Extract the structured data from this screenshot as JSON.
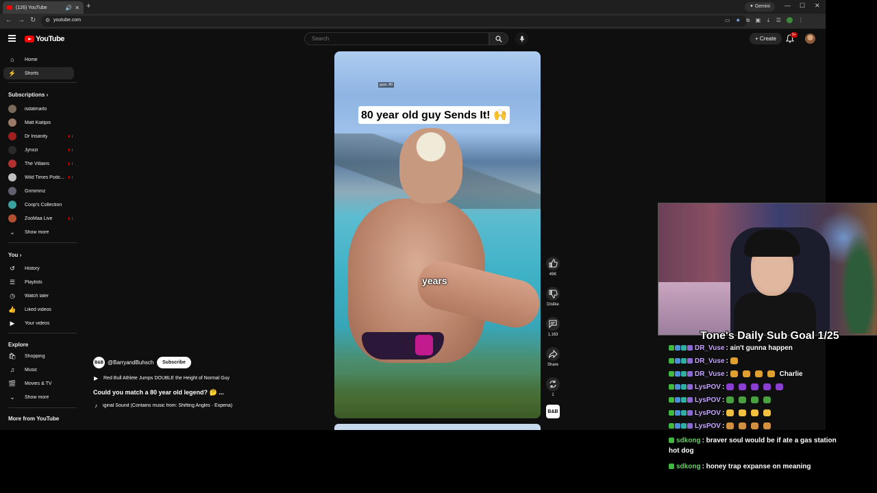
{
  "browser": {
    "tab_title": "(126) YouTube",
    "url": "youtube.com",
    "gemini_label": "Gemini"
  },
  "youtube": {
    "logo_text": "YouTube",
    "search_placeholder": "Search",
    "create_label": "Create",
    "notification_count": "9+",
    "sidebar": {
      "main": [
        {
          "label": "Home",
          "icon": "home-icon"
        },
        {
          "label": "Shorts",
          "icon": "shorts-icon",
          "active": true
        }
      ],
      "subscriptions_heading": "Subscriptions",
      "subscriptions": [
        {
          "label": "isdatmarlo",
          "color": "#7a6a5a",
          "live": false
        },
        {
          "label": "Matt Kiatipis",
          "color": "#9c7a6a",
          "live": false
        },
        {
          "label": "Dr Insanity",
          "color": "#a02020",
          "live": true
        },
        {
          "label": "Jynxzi",
          "color": "#2a2a2a",
          "live": true
        },
        {
          "label": "The Villains",
          "color": "#b03030",
          "live": true
        },
        {
          "label": "Wild Times Podc...",
          "color": "#c0c0c0",
          "live": true
        },
        {
          "label": "Grimmmz",
          "color": "#606070",
          "live": false
        },
        {
          "label": "Coop's Collection",
          "color": "#3aa0a0",
          "live": false
        },
        {
          "label": "ZooMaa Live",
          "color": "#b05030",
          "live": true
        }
      ],
      "show_more_1": "Show more",
      "you_heading": "You",
      "you": [
        {
          "label": "History",
          "icon": "history-icon"
        },
        {
          "label": "Playlists",
          "icon": "playlists-icon"
        },
        {
          "label": "Watch later",
          "icon": "watch-later-icon"
        },
        {
          "label": "Liked videos",
          "icon": "liked-videos-icon"
        },
        {
          "label": "Your videos",
          "icon": "your-videos-icon"
        }
      ],
      "explore_heading": "Explore",
      "explore": [
        {
          "label": "Shopping",
          "icon": "shopping-icon"
        },
        {
          "label": "Music",
          "icon": "music-icon"
        },
        {
          "label": "Movies & TV",
          "icon": "movies-icon"
        }
      ],
      "show_more_2": "Show more",
      "more_heading": "More from YouTube"
    },
    "short": {
      "watermark": "guys. 80",
      "caption_top": "80 year old guy Sends It! 🙌",
      "caption_mid": "years",
      "actions": [
        {
          "name": "like",
          "label": "49K"
        },
        {
          "name": "dislike",
          "label": "Dislike"
        },
        {
          "name": "comments",
          "label": "1,163"
        },
        {
          "name": "share",
          "label": "Share"
        },
        {
          "name": "remix",
          "label": "1"
        }
      ],
      "channel_badge": "B&B"
    },
    "meta": {
      "channel_avatar": "B&B",
      "handle": "@BarryandBuhsch",
      "subscribe_label": "Subscribe",
      "related": "Red Bull Athlete Jumps DOUBLE the Height of Normal Guy",
      "title": "Could you match a 80 year old legend? 🤔 ...",
      "sound": "iginal Sound (Contains music from: Shifting Angles · Experia)"
    }
  },
  "stream": {
    "sub_goal": "Tone's Daily Sub Goal 1/25",
    "chat": [
      {
        "user": "DR_Vuse",
        "user_color": "#c7a6ff",
        "text": ": ain't gunna happen",
        "emotes": 0,
        "emote_color": ""
      },
      {
        "user": "DR_Vuse",
        "user_color": "#c7a6ff",
        "text": ":",
        "emotes": 1,
        "emote_color": "#e0a030"
      },
      {
        "user": "DR_Vuse",
        "user_color": "#c7a6ff",
        "text": ":",
        "emotes": 4,
        "emote_color": "#e0a030",
        "suffix": "Charlie"
      },
      {
        "user": "LysPOV",
        "user_color": "#c7a6ff",
        "text": ":",
        "emotes": 5,
        "emote_color": "#8a3fd0"
      },
      {
        "user": "LysPOV",
        "user_color": "#c7a6ff",
        "text": ":",
        "emotes": 4,
        "emote_color": "#4aa040"
      },
      {
        "user": "LysPOV",
        "user_color": "#c7a6ff",
        "text": ":",
        "emotes": 4,
        "emote_color": "#f0c040"
      },
      {
        "user": "LysPOV",
        "user_color": "#c7a6ff",
        "text": ":",
        "emotes": 4,
        "emote_color": "#d09040"
      },
      {
        "user": "sdkong",
        "user_color": "#5fd35f",
        "text": ": braver soul would be if ate a gas station",
        "emotes": 0,
        "emote_color": ""
      },
      {
        "user": "",
        "user_color": "#ffffff",
        "text": "hot dog",
        "emotes": 0,
        "emote_color": ""
      },
      {
        "user": "sdkong",
        "user_color": "#5fd35f",
        "text": ": honey trap expanse on meaning",
        "emotes": 0,
        "emote_color": ""
      }
    ]
  }
}
